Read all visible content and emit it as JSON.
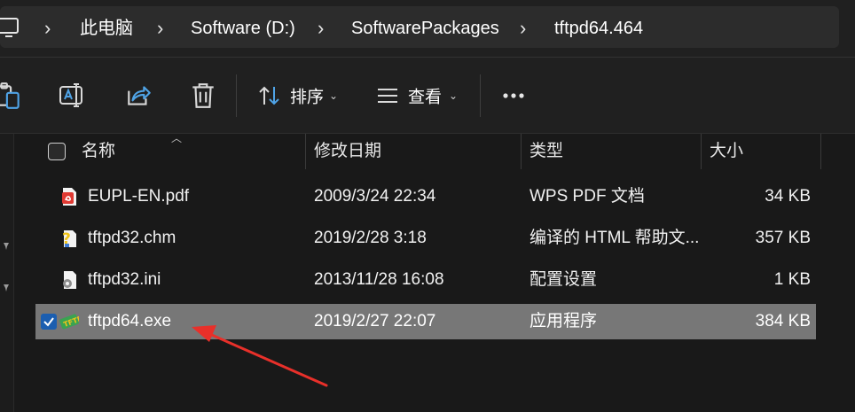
{
  "breadcrumb": {
    "items": [
      "此电脑",
      "Software (D:)",
      "SoftwarePackages",
      "tftpd64.464"
    ]
  },
  "toolbar": {
    "sort_label": "排序",
    "view_label": "查看",
    "more_label": "..."
  },
  "columns": {
    "name": "名称",
    "modified": "修改日期",
    "type": "类型",
    "size": "大小"
  },
  "files": [
    {
      "name": "EUPL-EN.pdf",
      "modified": "2009/3/24 22:34",
      "type": "WPS PDF 文档",
      "size": "34 KB",
      "icon": "pdf-icon",
      "selected": false
    },
    {
      "name": "tftpd32.chm",
      "modified": "2019/2/28 3:18",
      "type": "编译的 HTML 帮助文...",
      "size": "357 KB",
      "icon": "help-file-icon",
      "selected": false
    },
    {
      "name": "tftpd32.ini",
      "modified": "2013/11/28 16:08",
      "type": "配置设置",
      "size": "1 KB",
      "icon": "settings-file-icon",
      "selected": false
    },
    {
      "name": "tftpd64.exe",
      "modified": "2019/2/27 22:07",
      "type": "应用程序",
      "size": "384 KB",
      "icon": "exe-icon",
      "selected": true
    }
  ],
  "colors": {
    "background": "#191919",
    "toolbar": "#202020",
    "selection": "#777777",
    "checkbox_checked": "#1b5eb0",
    "annotation_arrow": "#e8302a"
  }
}
